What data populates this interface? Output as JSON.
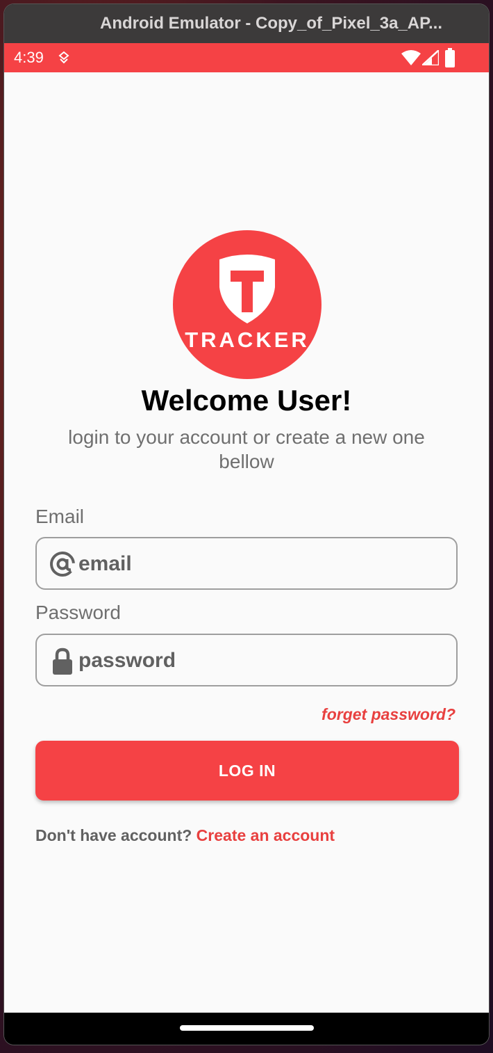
{
  "window": {
    "title": "Android Emulator - Copy_of_Pixel_3a_AP..."
  },
  "statusbar": {
    "time": "4:39"
  },
  "logo": {
    "text": "TRACKER"
  },
  "welcome": {
    "title": "Welcome User!",
    "subtitle": "login to your account or create a new one bellow"
  },
  "form": {
    "email_label": "Email",
    "email_placeholder": "email",
    "password_label": "Password",
    "password_placeholder": "password",
    "forgot_label": "forget password?",
    "login_label": "LOG IN",
    "signup_prompt": "Don't have account? ",
    "signup_link": "Create an account"
  },
  "colors": {
    "accent": "#f54245",
    "link": "#e8403f",
    "muted_text": "#6f6f6f"
  },
  "icons": [
    "at-sign-icon",
    "lock-icon",
    "shield-icon",
    "wifi-icon",
    "signal-icon",
    "battery-icon",
    "notification-icon"
  ]
}
